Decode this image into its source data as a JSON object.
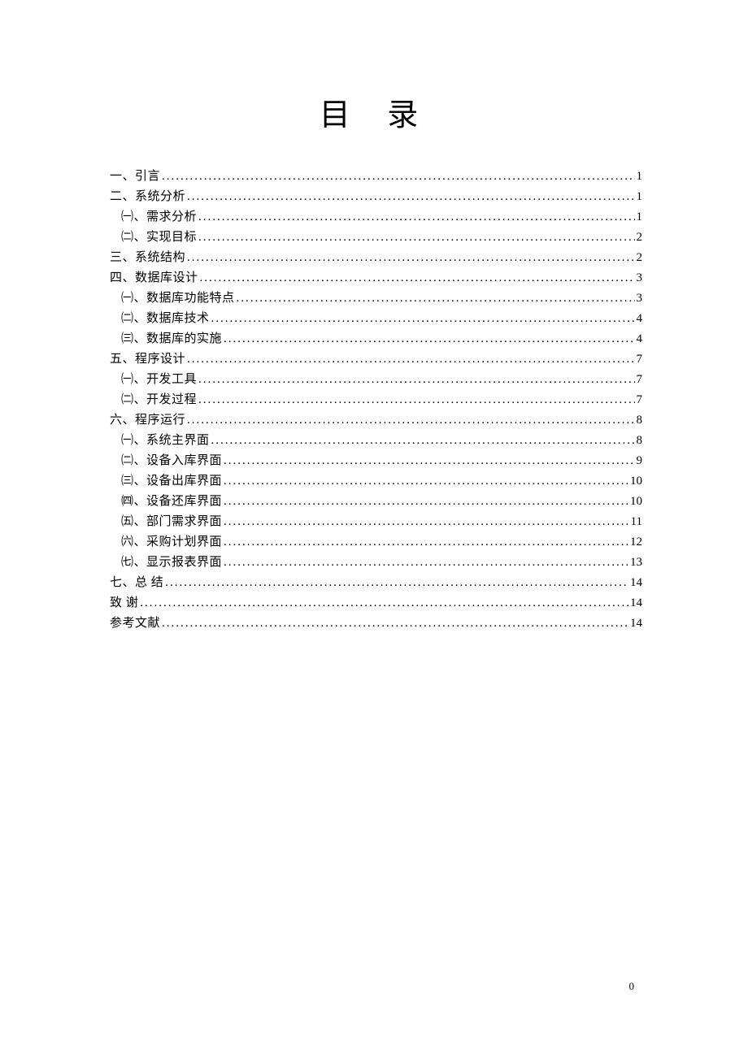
{
  "title": "目 录",
  "footer_page_number": "0",
  "toc": [
    {
      "label": "一、引言",
      "page": "1",
      "level": 0
    },
    {
      "label": "二、系统分析",
      "page": "1",
      "level": 0
    },
    {
      "label": "㈠、需求分析",
      "page": "1",
      "level": 1
    },
    {
      "label": "㈡、实现目标",
      "page": "2",
      "level": 1
    },
    {
      "label": "三、系统结构",
      "page": "2",
      "level": 0
    },
    {
      "label": "四、数据库设计",
      "page": "3",
      "level": 0
    },
    {
      "label": "㈠、数据库功能特点",
      "page": "3",
      "level": 1
    },
    {
      "label": "㈡、数据库技术",
      "page": "4",
      "level": 1
    },
    {
      "label": "㈢、数据库的实施",
      "page": "4",
      "level": 1
    },
    {
      "label": "五、程序设计",
      "page": "7",
      "level": 0
    },
    {
      "label": "㈠、开发工具",
      "page": "7",
      "level": 1
    },
    {
      "label": "㈡、开发过程",
      "page": "7",
      "level": 1
    },
    {
      "label": "六、程序运行",
      "page": "8",
      "level": 0
    },
    {
      "label": "㈠、系统主界面",
      "page": "8",
      "level": 1
    },
    {
      "label": "㈡、设备入库界面",
      "page": "9",
      "level": 1
    },
    {
      "label": "㈢、设备出库界面",
      "page": "10",
      "level": 1
    },
    {
      "label": "㈣、设备还库界面",
      "page": "10",
      "level": 1
    },
    {
      "label": "㈤、部门需求界面",
      "page": "11",
      "level": 1
    },
    {
      "label": "㈥、采购计划界面",
      "page": "12",
      "level": 1
    },
    {
      "label": "㈦、显示报表界面",
      "page": "13",
      "level": 1
    },
    {
      "label": "七、总 结",
      "page": "14",
      "level": 0
    },
    {
      "label": "致 谢",
      "page": "14",
      "level": 0
    },
    {
      "label": "参考文献",
      "page": "14",
      "level": 0
    }
  ]
}
